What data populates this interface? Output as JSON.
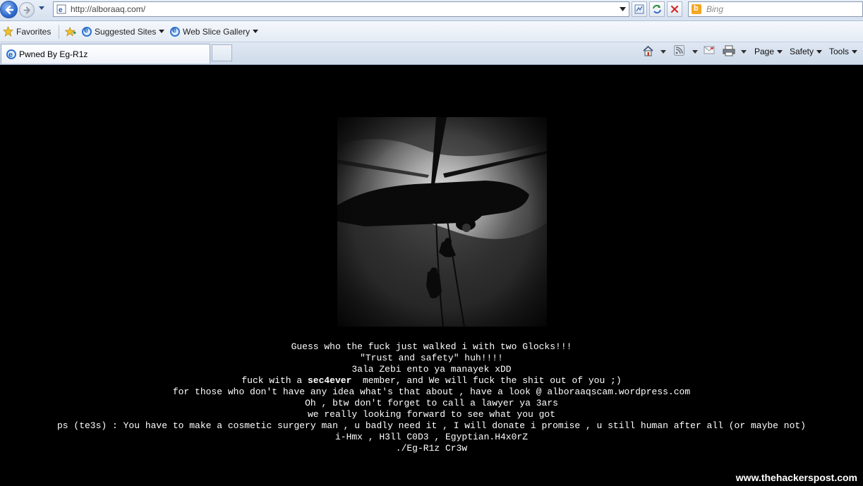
{
  "browser": {
    "url": "http://alboraaq.com/",
    "search_placeholder": "Bing"
  },
  "favorites_bar": {
    "favorites_label": "Favorites",
    "suggested_sites_label": "Suggested Sites",
    "web_slice_gallery_label": "Web Slice Gallery"
  },
  "tab": {
    "title": "Pwned By Eg-R1z"
  },
  "command_bar": {
    "page_label": "Page",
    "safety_label": "Safety",
    "tools_label": "Tools"
  },
  "page": {
    "hero_icon": "helicopter-rappel-image",
    "lines": [
      "Guess who the fuck just walked i with two Glocks!!!",
      "\"Trust and safety\" huh!!!!",
      "3ala Zebi ento ya manayek xDD",
      "fuck with a ",
      "sec4ever",
      "  member, and We will fuck the shit out of you ;)",
      "for those who don't have any idea what's that about , have a look @ alboraaqscam.wordpress.com",
      "Oh , btw don't forget to call a lawyer ya 3ars",
      "we really looking forward to see what you got",
      "ps (te3s) : You have to make a cosmetic surgery man , u badly need it , I will donate i promise , u still human after all (or maybe not)",
      "i-Hmx , H3ll C0D3 , Egyptian.H4x0rZ",
      "./Eg-R1z Cr3w"
    ],
    "watermark": "www.thehackerspost.com"
  },
  "colors": {
    "page_background": "#000000",
    "text": "#ffffff",
    "chrome_blue": "#2f6bcf"
  }
}
